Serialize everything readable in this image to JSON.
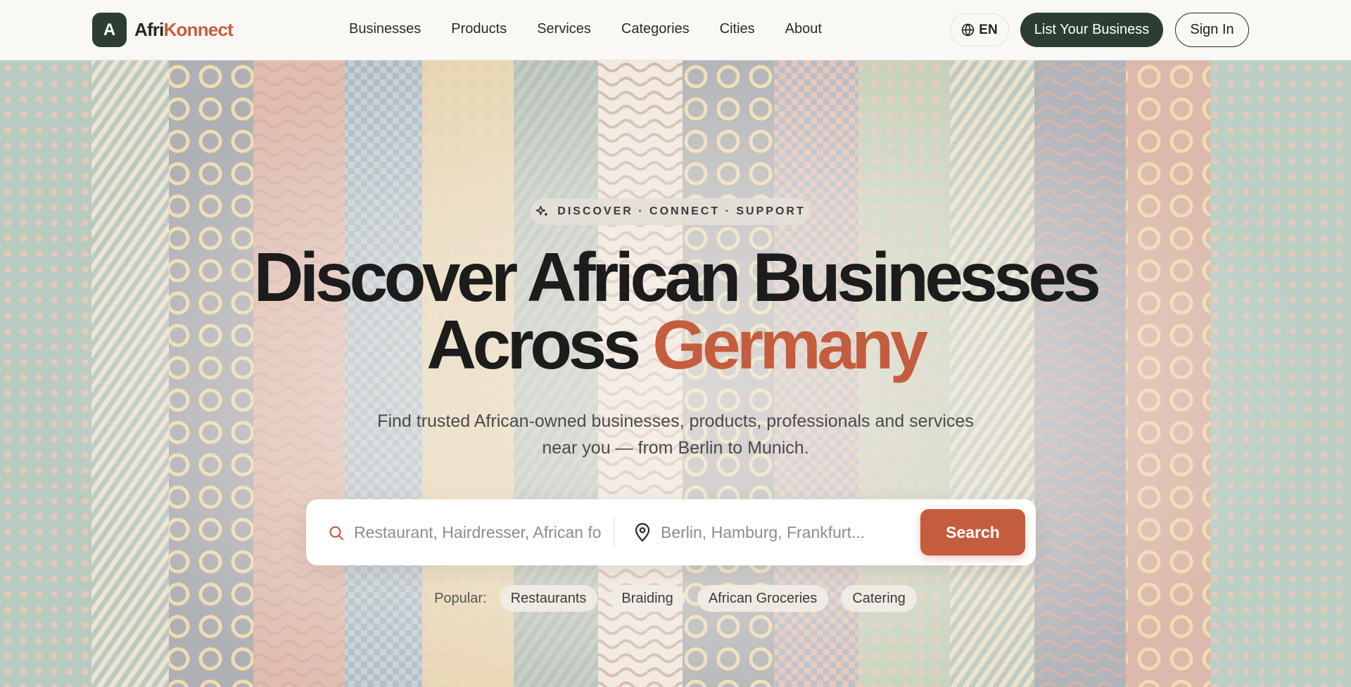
{
  "brand": {
    "mark": "A",
    "name_part1": "Afri",
    "name_part2": "Konnect",
    "primary_color": "#2c3e34",
    "accent_color": "#c45d3e"
  },
  "nav": {
    "items": [
      "Businesses",
      "Products",
      "Services",
      "Categories",
      "Cities",
      "About"
    ]
  },
  "header": {
    "language": "EN",
    "language_icon": "globe-icon",
    "list_business_label": "List Your Business",
    "signin_label": "Sign In"
  },
  "hero": {
    "badge_icon": "sparkle-icon",
    "badge": "DISCOVER · CONNECT · SUPPORT",
    "headline_line1": "Discover African Businesses",
    "headline_line2_plain": "Across",
    "headline_line2_accent": "Germany",
    "subline_line1": "Find trusted African-owned businesses, products, professionals and services",
    "subline_line2": "near you — from Berlin to Munich."
  },
  "search": {
    "query_icon": "search-icon",
    "query_value": "",
    "query_placeholder": "Restaurant, Hairdresser, African fo",
    "location_icon": "map-pin-icon",
    "location_value": "",
    "location_placeholder": "Berlin, Hamburg, Frankfurt...",
    "button_label": "Search"
  },
  "popular": {
    "label": "Popular:",
    "chips": [
      "Restaurants",
      "Braiding",
      "African Groceries",
      "Catering"
    ]
  }
}
